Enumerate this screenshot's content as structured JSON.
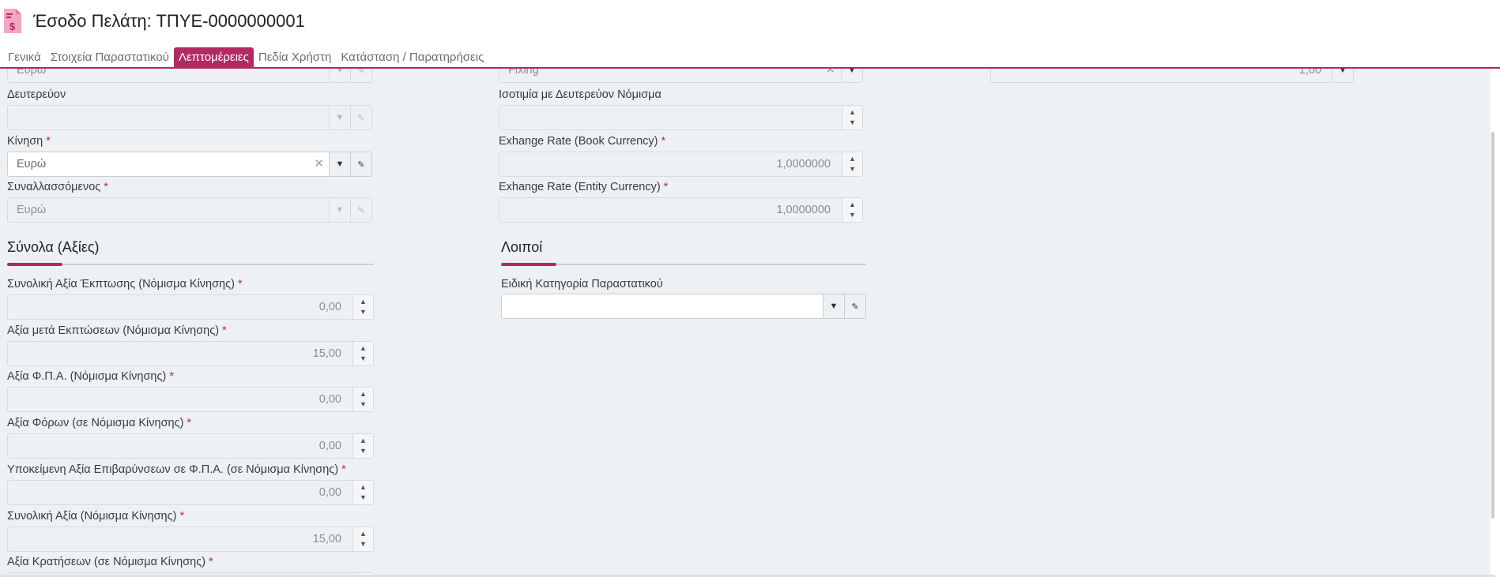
{
  "header": {
    "title": "Έσοδο Πελάτη: ΤΠΥΕ-0000000001",
    "icon": "invoice-dollar-icon",
    "accent_color": "#b12b62"
  },
  "tabs": [
    {
      "label": "Γενικά"
    },
    {
      "label": "Στοιχεία Παραστατικού"
    },
    {
      "label": "Λεπτομέρειες",
      "active": true
    },
    {
      "label": "Πεδία Χρήστη"
    },
    {
      "label": "Κατάσταση / Παρατηρήσεις"
    }
  ],
  "top_partial": {
    "left_value": "Ευρώ",
    "mid_value": "Fixing",
    "right_value": "1,00"
  },
  "currency": {
    "secondary_label": "Δευτερεύον",
    "secondary_value": "",
    "movement_label": "Κίνηση",
    "movement_value": "Ευρώ",
    "counterparty_label": "Συναλλασσόμενος",
    "counterparty_value": "Ευρώ"
  },
  "rates": {
    "parity_label": "Ισοτιμία με Δευτερεύον Νόμισμα",
    "parity_value": "",
    "book_label": "Exhange Rate (Book Currency)",
    "book_value": "1,0000000",
    "entity_label": "Exhange Rate (Entity Currency)",
    "entity_value": "1,0000000"
  },
  "totals": {
    "title": "Σύνολα (Αξίες)",
    "fields": [
      {
        "label": "Συνολική Αξία Έκπτωσης (Νόμισμα Κίνησης)",
        "value": "0,00"
      },
      {
        "label": "Αξία μετά Εκπτώσεων (Νόμισμα Κίνησης)",
        "value": "15,00"
      },
      {
        "label": "Αξία Φ.Π.Α. (Νόμισμα Κίνησης)",
        "value": "0,00"
      },
      {
        "label": "Αξία Φόρων (σε Νόμισμα Κίνησης)",
        "value": "0,00"
      },
      {
        "label": "Υποκείμενη Αξία Επιβαρύνσεων σε Φ.Π.Α. (σε Νόμισμα Κίνησης)",
        "value": "0,00"
      },
      {
        "label": "Συνολική Αξία (Νόμισμα Κίνησης)",
        "value": "15,00"
      },
      {
        "label": "Αξία Κρατήσεων (σε Νόμισμα Κίνησης)",
        "value": ""
      }
    ]
  },
  "other": {
    "title": "Λοιποί",
    "special_label": "Ειδική Κατηγορία Παραστατικού",
    "special_value": ""
  },
  "glyphs": {
    "required": "*",
    "clear": "✕",
    "dropdown": "▼",
    "up": "▲",
    "down": "▼"
  }
}
